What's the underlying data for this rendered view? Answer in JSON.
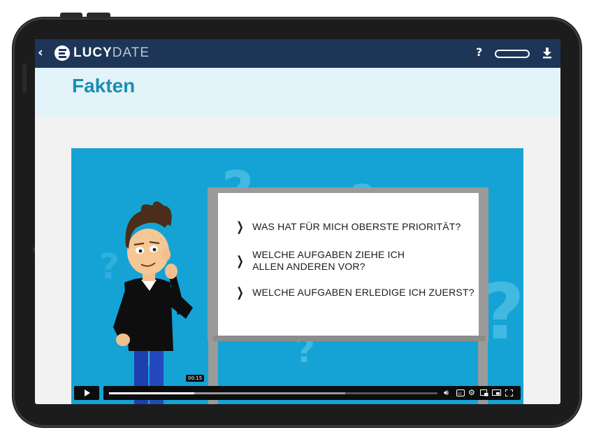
{
  "app": {
    "back_glyph": "‹",
    "brand_bold": "LUCY",
    "brand_light": "DATE",
    "help_label": "?",
    "progress_fraction": 0
  },
  "page": {
    "title": "Fakten"
  },
  "video": {
    "bullets": [
      {
        "lines": [
          "WAS HAT FÜR MICH OBERSTE PRIORITÄT?"
        ]
      },
      {
        "lines": [
          "WELCHE AUFGABEN ZIEHE ICH",
          "ALLEN ANDEREN VOR?"
        ]
      },
      {
        "lines": [
          "WELCHE AUFGABEN ERLEDIGE ICH ZUERST?"
        ]
      }
    ],
    "player": {
      "time_tooltip": "00:15",
      "played_fraction": 0.26,
      "buffered_fraction": 0.72
    }
  },
  "colors": {
    "topbar": "#1d3557",
    "heading": "#1a8fb0",
    "heading_band": "#e3f3fa",
    "video_bg": "#14a3d4"
  },
  "icons": [
    "back-chevron-icon",
    "lucydate-logo-icon",
    "help-icon",
    "download-icon",
    "play-icon",
    "volume-icon",
    "captions-icon",
    "settings-icon",
    "picture-in-picture-icon",
    "cast-icon",
    "fullscreen-icon"
  ]
}
